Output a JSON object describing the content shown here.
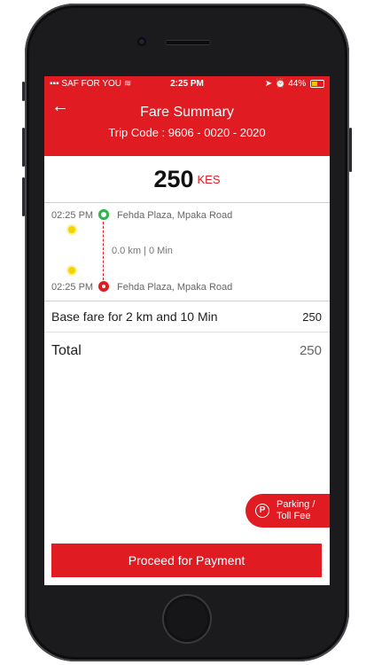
{
  "status": {
    "carrier": "SAF FOR YOU",
    "time": "2:25 PM",
    "battery": "44%"
  },
  "header": {
    "title": "Fare Summary",
    "trip_code": "Trip Code : 9606 - 0020 - 2020"
  },
  "fare": {
    "amount": "250",
    "currency": "KES"
  },
  "trip": {
    "start_time": "02:25 PM",
    "start_place": "Fehda Plaza, Mpaka Road",
    "distance": "0.0 km | 0 Min",
    "end_time": "02:25 PM",
    "end_place": "Fehda Plaza, Mpaka Road"
  },
  "breakdown": {
    "base_label": "Base fare for 2 km and 10 Min",
    "base_value": "250",
    "total_label": "Total",
    "total_value": "250"
  },
  "parking": {
    "icon_letter": "P",
    "label_line1": "Parking /",
    "label_line2": "Toll Fee"
  },
  "actions": {
    "proceed_label": "Proceed for Payment"
  },
  "colors": {
    "brand": "#e01b22",
    "start_marker": "#2db84d"
  }
}
